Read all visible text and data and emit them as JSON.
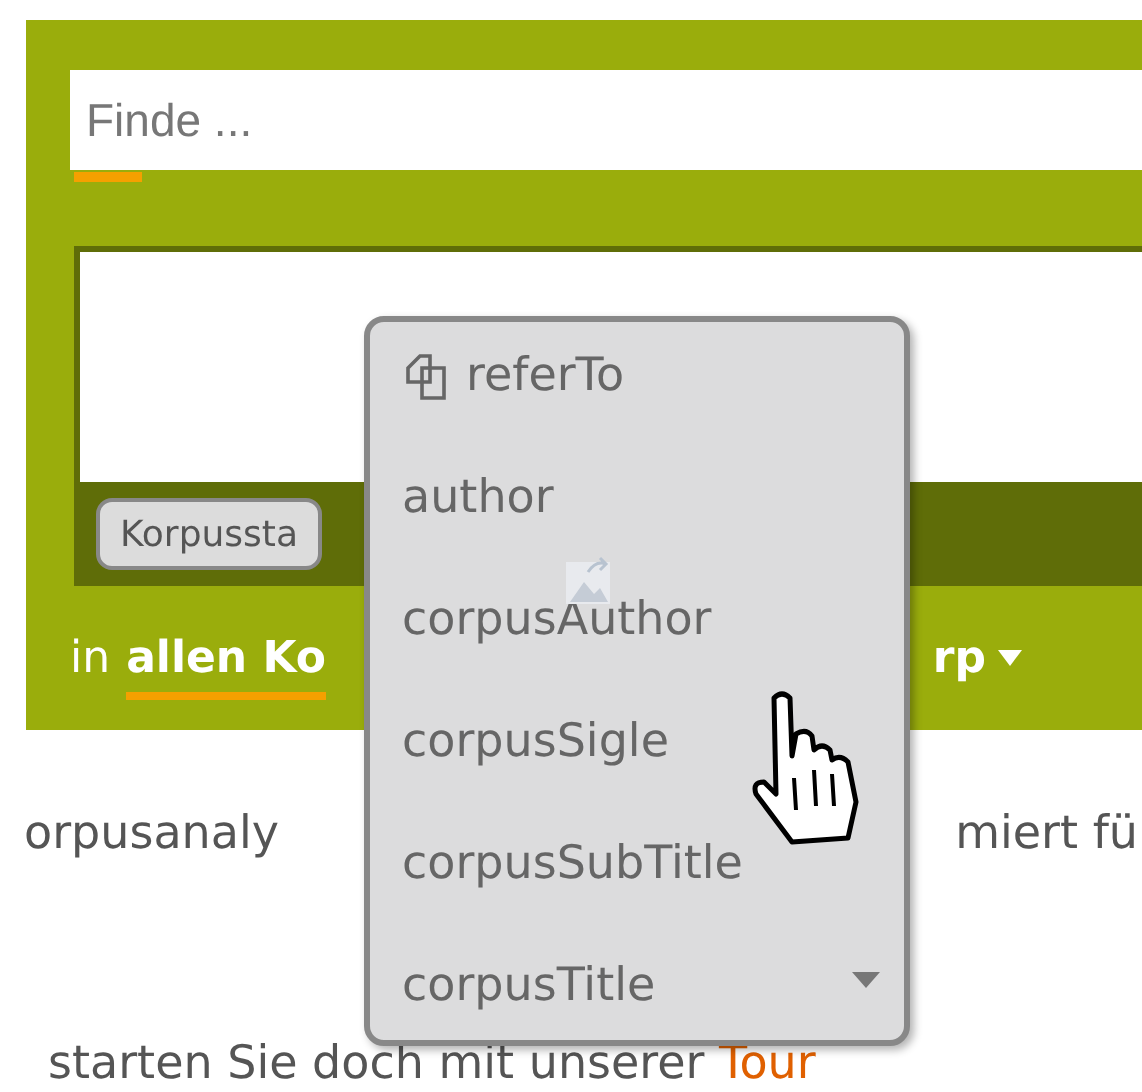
{
  "search": {
    "placeholder": "Finde ..."
  },
  "query_bar": {
    "button": "Korpussta"
  },
  "corpus_line": {
    "prefix": "in",
    "selected_part": "allen Ko",
    "cut_part": "rp"
  },
  "intro": {
    "line_1_left": "orpusanaly",
    "line_1_right": "miert fü",
    "line_2": "starten Sie doch mit unserer",
    "link": "Tour"
  },
  "menu": {
    "items": [
      {
        "label": "referTo",
        "kind": "reference"
      },
      {
        "label": "author",
        "kind": "field"
      },
      {
        "label": "corpusAuthor",
        "kind": "field"
      },
      {
        "label": "corpusSigle",
        "kind": "field"
      },
      {
        "label": "corpusSubTitle",
        "kind": "field"
      },
      {
        "label": "corpusTitle",
        "kind": "field"
      }
    ]
  }
}
